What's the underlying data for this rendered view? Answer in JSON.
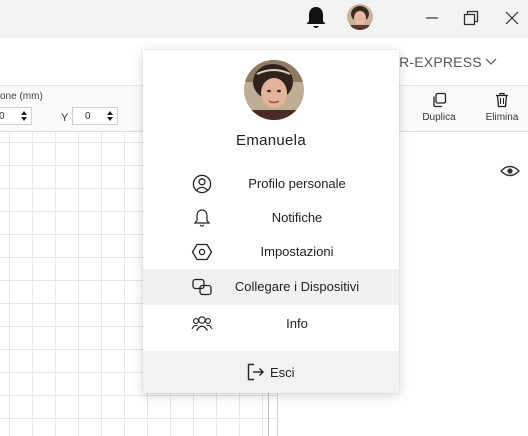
{
  "titlebar": {
    "icons": [
      "bell-icon",
      "avatar",
      "minimize-icon",
      "restore-icon",
      "close-icon"
    ]
  },
  "header": {
    "machine_label": "OR-EXPRESS"
  },
  "toolbar": {
    "position_label": "one (mm)",
    "x_value": "0",
    "y_label": "Y",
    "y_value": "0",
    "duplicate_label": "Duplica",
    "delete_label": "Elimina"
  },
  "menu": {
    "user_name": "Emanuela",
    "items": [
      {
        "label": "Profilo personale",
        "icon": "user-circle-icon"
      },
      {
        "label": "Notifiche",
        "icon": "bell-outline-icon"
      },
      {
        "label": "Impostazioni",
        "icon": "hexagon-settings-icon"
      },
      {
        "label": "Collegare i Dispositivi",
        "icon": "link-devices-icon"
      },
      {
        "label": "Info",
        "icon": "group-icon"
      }
    ],
    "logout_label": "Esci"
  },
  "colors": {
    "titlebar_bg": "#f2f3f3",
    "menu_hover_bg": "#f1f1f1",
    "footer_bg": "#f1f2f2"
  }
}
